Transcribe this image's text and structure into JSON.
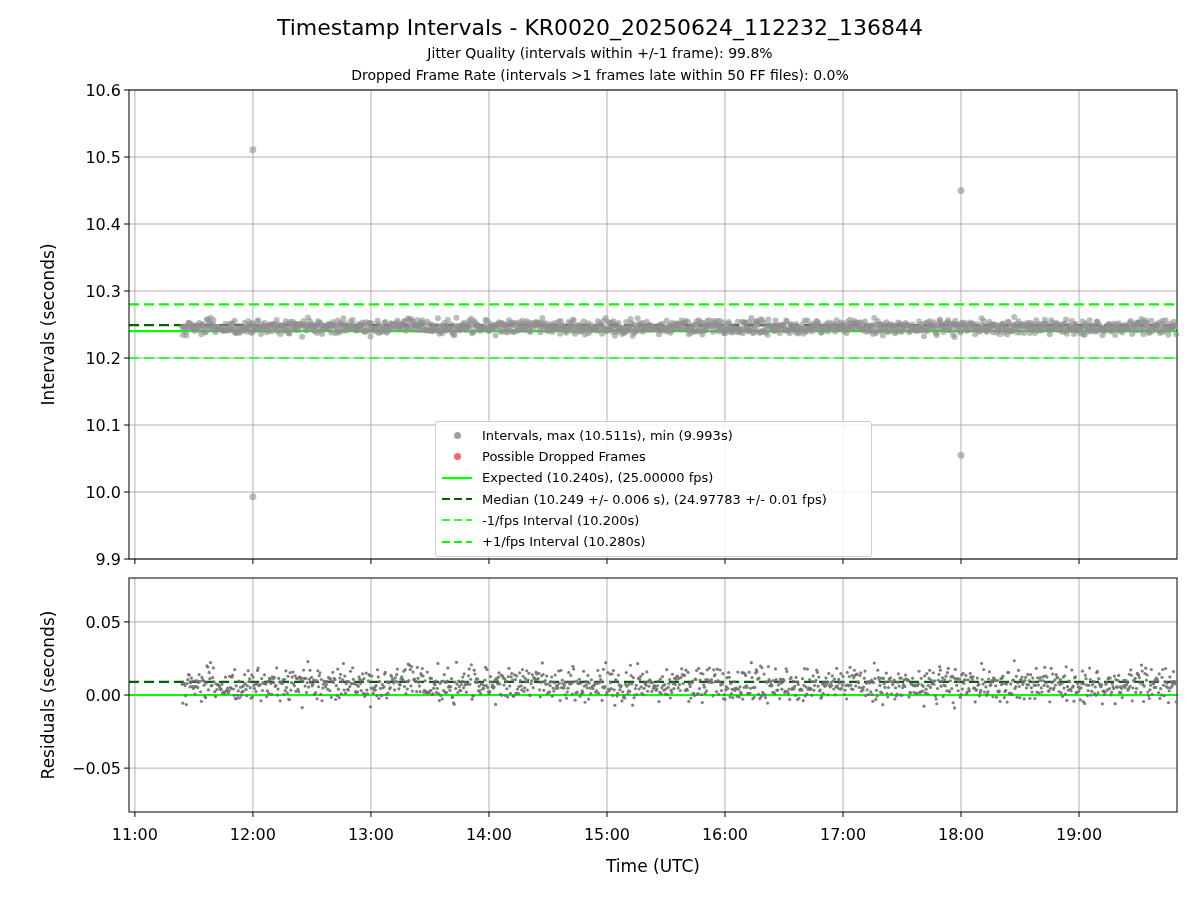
{
  "title": "Timestamp Intervals - KR0020_20250624_112232_136844",
  "subtitles": [
    "Jitter Quality (intervals within +/-1 frame): 99.8%",
    "Dropped Frame Rate (intervals >1 frames late within 50 FF files): 0.0%"
  ],
  "top_panel": {
    "chart_data": {
      "type": "line",
      "ylabel": "Intervals (seconds)",
      "x": [
        10.95,
        19.83
      ],
      "xlim": [
        10.95,
        19.83
      ],
      "ylim": [
        9.9,
        10.6
      ],
      "yticks": [
        {
          "value": 9.9,
          "label": "9.9"
        },
        {
          "value": 10.0,
          "label": "10.0"
        },
        {
          "value": 10.1,
          "label": "10.1"
        },
        {
          "value": 10.2,
          "label": "10.2"
        },
        {
          "value": 10.3,
          "label": "10.3"
        },
        {
          "value": 10.4,
          "label": "10.4"
        },
        {
          "value": 10.5,
          "label": "10.5"
        },
        {
          "value": 10.6,
          "label": "10.6"
        }
      ],
      "series": [
        {
          "name": "Expected (10.240s), (25.00000 fps)",
          "color": "#00ff00",
          "line_style": "solid",
          "values": [
            10.24,
            10.24
          ]
        },
        {
          "name": "Median (10.249 +/- 0.006 s), (24.97783 +/- 0.01 fps)",
          "color": "#006400",
          "line_style": "dashed",
          "values": [
            10.249,
            10.249
          ]
        },
        {
          "name": "-1/fps Interval (10.200s)",
          "color": "#32ff32",
          "line_style": "dashed",
          "values": [
            10.2,
            10.2
          ]
        },
        {
          "name": "+1/fps Interval (10.280s)",
          "color": "#00ff00",
          "line_style": "dashed",
          "values": [
            10.28,
            10.28
          ]
        }
      ],
      "grid": true
    },
    "markers": [
      {
        "name": "Intervals, max (10.511s), min (9.993s)",
        "color": "#a0a0a0"
      },
      {
        "name": "Possible Dropped Frames",
        "color": "#ff6464"
      }
    ]
  },
  "bottom_panel": {
    "chart_data": {
      "type": "line",
      "ylabel": "Residuals (seconds)",
      "xlabel": "Time (UTC)",
      "x": [
        10.95,
        19.83
      ],
      "xlim": [
        10.95,
        19.83
      ],
      "ylim": [
        -0.08,
        0.08
      ],
      "xticks": [
        {
          "value": 11,
          "label": "11:00"
        },
        {
          "value": 12,
          "label": "12:00"
        },
        {
          "value": 13,
          "label": "13:00"
        },
        {
          "value": 14,
          "label": "14:00"
        },
        {
          "value": 15,
          "label": "15:00"
        },
        {
          "value": 16,
          "label": "16:00"
        },
        {
          "value": 17,
          "label": "17:00"
        },
        {
          "value": 18,
          "label": "18:00"
        },
        {
          "value": 19,
          "label": "19:00"
        }
      ],
      "yticks": [
        {
          "value": -0.05,
          "label": "−0.05"
        },
        {
          "value": 0,
          "label": "0.00"
        },
        {
          "value": 0.05,
          "label": "0.05"
        }
      ],
      "series": [
        {
          "color": "#00ff00",
          "line_style": "solid",
          "values": [
            0,
            0
          ]
        },
        {
          "color": "#006400",
          "line_style": "dashed",
          "values": [
            0.009,
            0.009
          ]
        }
      ],
      "grid": true
    }
  }
}
